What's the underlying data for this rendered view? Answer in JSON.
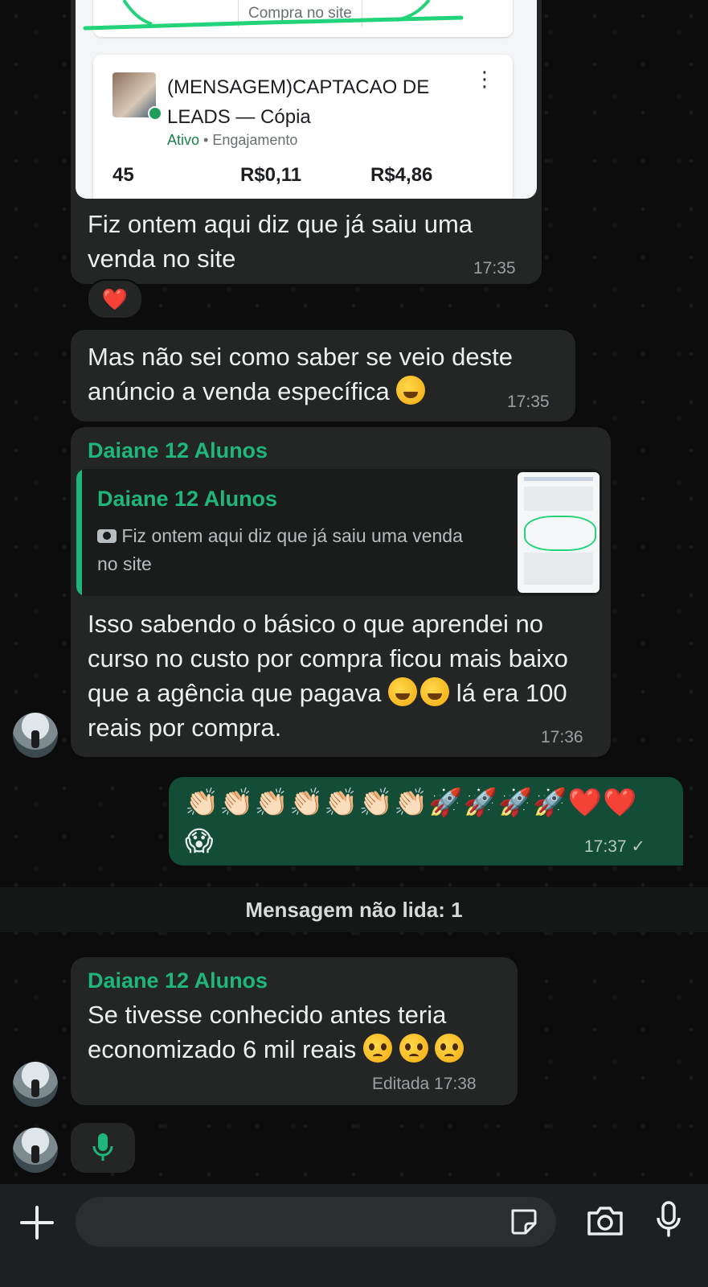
{
  "ad_card_top": {
    "purchase_label": "Compra no site"
  },
  "ad_card": {
    "title": "(MENSAGEM)CAPTACAO DE LEADS — Cópia",
    "status": "Ativo",
    "objective": "• Engajamento",
    "results": "45",
    "cost_per_result": "R$0,11",
    "amount_spent": "R$4,86"
  },
  "messages": [
    {
      "text": "Fiz ontem aqui diz que já saiu uma venda no site",
      "time": "17:35",
      "reaction": "❤️"
    },
    {
      "text": "Mas não sei como saber se veio deste anúncio a venda específica",
      "time": "17:35"
    },
    {
      "sender": "Daiane 12 Alunos",
      "quote_sender": "Daiane 12 Alunos",
      "quote_text": "Fiz ontem aqui diz que já saiu uma venda no site",
      "text": "Isso sabendo o básico o que aprendei no curso no custo por compra ficou mais baixo que a agência que pagava",
      "text_tail": "lá era 100 reais por compra.",
      "time": "17:36"
    },
    {
      "text": "👏🏻👏🏻👏🏻👏🏻👏🏻👏🏻👏🏻🚀🚀🚀🚀❤️❤️",
      "text2": "😱",
      "time": "17:37 ✓"
    },
    {
      "sender": "Daiane 12 Alunos",
      "text": "Se tivesse conhecido antes teria economizado 6 mil reais",
      "time": "Editada 17:38"
    }
  ],
  "unread_divider": "Mensagem não lida: 1",
  "colors": {
    "accent": "#1fb67b",
    "outgoing_bubble": "#134d37",
    "incoming_bubble": "#242626"
  },
  "input_bar": {
    "plus_icon": "plus-icon",
    "sticker_icon": "sticker-icon",
    "camera_icon": "camera-icon",
    "mic_icon": "mic-icon"
  }
}
